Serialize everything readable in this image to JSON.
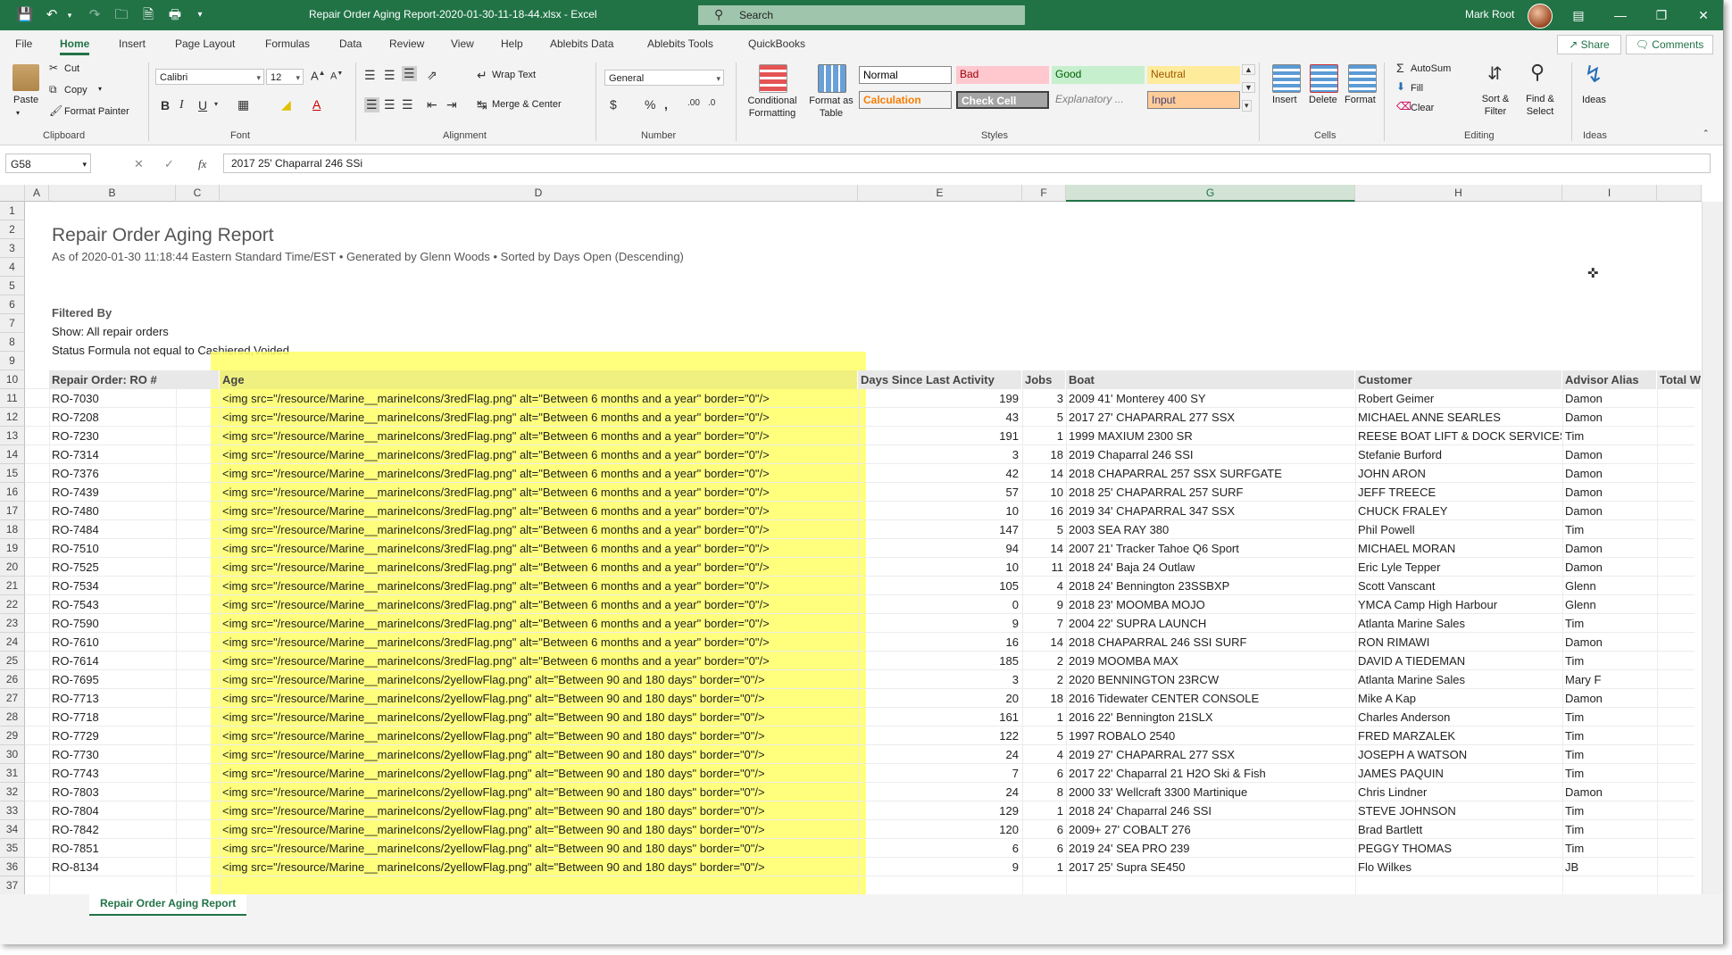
{
  "window": {
    "title": "Repair Order Aging Report-2020-01-30-11-18-44.xlsx  -  Excel",
    "search_placeholder": "Search",
    "user": "Mark Root"
  },
  "menu": {
    "tabs": [
      "File",
      "Home",
      "Insert",
      "Page Layout",
      "Formulas",
      "Data",
      "Review",
      "View",
      "Help",
      "Ablebits Data",
      "Ablebits Tools",
      "QuickBooks"
    ],
    "share": "Share",
    "comments": "Comments"
  },
  "ribbon": {
    "clipboard": {
      "paste": "Paste",
      "cut": "Cut",
      "copy": "Copy",
      "format_painter": "Format Painter",
      "label": "Clipboard"
    },
    "font": {
      "name": "Calibri",
      "size": "12",
      "label": "Font"
    },
    "alignment": {
      "wrap": "Wrap Text",
      "merge": "Merge & Center",
      "label": "Alignment"
    },
    "number": {
      "format": "General",
      "label": "Number"
    },
    "styles": {
      "conditional": "Conditional Formatting",
      "format_table": "Format as Table",
      "normal": "Normal",
      "bad": "Bad",
      "good": "Good",
      "neutral": "Neutral",
      "calculation": "Calculation",
      "check_cell": "Check Cell",
      "explanatory": "Explanatory ...",
      "input": "Input",
      "label": "Styles"
    },
    "cells": {
      "insert": "Insert",
      "delete": "Delete",
      "format": "Format",
      "label": "Cells"
    },
    "editing": {
      "autosum": "AutoSum",
      "fill": "Fill",
      "clear": "Clear",
      "sort": "Sort & Filter",
      "find": "Find & Select",
      "label": "Editing"
    },
    "ideas": {
      "ideas": "Ideas",
      "label": "Ideas"
    }
  },
  "formula_bar": {
    "name_box": "G58",
    "formula": "2017 25' Chaparral 246 SSi"
  },
  "columns": [
    "A",
    "B",
    "C",
    "D",
    "E",
    "F",
    "G",
    "H",
    "I"
  ],
  "sheet": {
    "title": "Repair Order Aging Report",
    "subtitle": "As of 2020-01-30 11:18:44 Eastern Standard Time/EST • Generated by Glenn Woods • Sorted by Days Open (Descending)",
    "filtered_by": "Filtered By",
    "filter1": "Show: All repair orders",
    "filter2": "Status Formula not equal to Cashiered,Voided",
    "headers": [
      "Repair Order: RO #",
      "Age",
      "Days Since Last Activity",
      "Jobs",
      "Boat",
      "Customer",
      "Advisor Alias",
      "Total W"
    ],
    "rows": [
      [
        "RO-7030",
        "<img src=\"/resource/Marine__marineIcons/3redFlag.png\" alt=\"Between 6 months and a year\" border=\"0\"/>",
        "199",
        "3",
        "2009 41' Monterey 400 SY",
        "Robert Geimer",
        "Damon"
      ],
      [
        "RO-7208",
        "<img src=\"/resource/Marine__marineIcons/3redFlag.png\" alt=\"Between 6 months and a year\" border=\"0\"/>",
        "43",
        "5",
        "2017 27' CHAPARRAL 277 SSX",
        "MICHAEL ANNE SEARLES",
        "Damon"
      ],
      [
        "RO-7230",
        "<img src=\"/resource/Marine__marineIcons/3redFlag.png\" alt=\"Between 6 months and a year\" border=\"0\"/>",
        "191",
        "1",
        "1999 MAXIUM 2300 SR",
        "REESE BOAT LIFT & DOCK SERVICES",
        "Tim"
      ],
      [
        "RO-7314",
        "<img src=\"/resource/Marine__marineIcons/3redFlag.png\" alt=\"Between 6 months and a year\" border=\"0\"/>",
        "3",
        "18",
        "2019 Chaparral 246 SSI",
        "Stefanie Burford",
        "Damon"
      ],
      [
        "RO-7376",
        "<img src=\"/resource/Marine__marineIcons/3redFlag.png\" alt=\"Between 6 months and a year\" border=\"0\"/>",
        "42",
        "14",
        "2018 CHAPARRAL 257 SSX SURFGATE",
        "JOHN ARON",
        "Damon"
      ],
      [
        "RO-7439",
        "<img src=\"/resource/Marine__marineIcons/3redFlag.png\" alt=\"Between 6 months and a year\" border=\"0\"/>",
        "57",
        "10",
        "2018 25' CHAPARRAL 257 SURF",
        "JEFF TREECE",
        "Damon"
      ],
      [
        "RO-7480",
        "<img src=\"/resource/Marine__marineIcons/3redFlag.png\" alt=\"Between 6 months and a year\" border=\"0\"/>",
        "10",
        "16",
        "2019 34' CHAPARRAL 347 SSX",
        "CHUCK FRALEY",
        "Damon"
      ],
      [
        "RO-7484",
        "<img src=\"/resource/Marine__marineIcons/3redFlag.png\" alt=\"Between 6 months and a year\" border=\"0\"/>",
        "147",
        "5",
        "2003 SEA RAY 380",
        "Phil Powell",
        "Tim"
      ],
      [
        "RO-7510",
        "<img src=\"/resource/Marine__marineIcons/3redFlag.png\" alt=\"Between 6 months and a year\" border=\"0\"/>",
        "94",
        "14",
        "2007 21' Tracker Tahoe Q6 Sport",
        "MICHAEL MORAN",
        "Damon"
      ],
      [
        "RO-7525",
        "<img src=\"/resource/Marine__marineIcons/3redFlag.png\" alt=\"Between 6 months and a year\" border=\"0\"/>",
        "10",
        "11",
        "2018 24' Baja 24 Outlaw",
        "Eric Lyle Tepper",
        "Damon"
      ],
      [
        "RO-7534",
        "<img src=\"/resource/Marine__marineIcons/3redFlag.png\" alt=\"Between 6 months and a year\" border=\"0\"/>",
        "105",
        "4",
        "2018 24' Bennington 23SSBXP",
        "Scott Vanscant",
        "Glenn"
      ],
      [
        "RO-7543",
        "<img src=\"/resource/Marine__marineIcons/3redFlag.png\" alt=\"Between 6 months and a year\" border=\"0\"/>",
        "0",
        "9",
        "2018 23' MOOMBA MOJO",
        "YMCA Camp High Harbour",
        "Glenn"
      ],
      [
        "RO-7590",
        "<img src=\"/resource/Marine__marineIcons/3redFlag.png\" alt=\"Between 6 months and a year\" border=\"0\"/>",
        "9",
        "7",
        "2004 22' SUPRA LAUNCH",
        "Atlanta Marine Sales",
        "Tim"
      ],
      [
        "RO-7610",
        "<img src=\"/resource/Marine__marineIcons/3redFlag.png\" alt=\"Between 6 months and a year\" border=\"0\"/>",
        "16",
        "14",
        "2018 CHAPARRAL 246 SSI SURF",
        "RON RIMAWI",
        "Damon"
      ],
      [
        "RO-7614",
        "<img src=\"/resource/Marine__marineIcons/3redFlag.png\" alt=\"Between 6 months and a year\" border=\"0\"/>",
        "185",
        "2",
        "2019 MOOMBA MAX",
        "DAVID A TIEDEMAN",
        "Tim"
      ],
      [
        "RO-7695",
        "<img src=\"/resource/Marine__marineIcons/2yellowFlag.png\" alt=\"Between 90 and 180 days\" border=\"0\"/>",
        "3",
        "2",
        "2020 BENNINGTON 23RCW",
        "Atlanta Marine Sales",
        "Mary F"
      ],
      [
        "RO-7713",
        "<img src=\"/resource/Marine__marineIcons/2yellowFlag.png\" alt=\"Between 90 and 180 days\" border=\"0\"/>",
        "20",
        "18",
        "2016 Tidewater CENTER CONSOLE",
        "Mike A Kap",
        "Damon"
      ],
      [
        "RO-7718",
        "<img src=\"/resource/Marine__marineIcons/2yellowFlag.png\" alt=\"Between 90 and 180 days\" border=\"0\"/>",
        "161",
        "1",
        "2016 22' Bennington 21SLX",
        "Charles Anderson",
        "Tim"
      ],
      [
        "RO-7729",
        "<img src=\"/resource/Marine__marineIcons/2yellowFlag.png\" alt=\"Between 90 and 180 days\" border=\"0\"/>",
        "122",
        "5",
        "1997 ROBALO 2540",
        "FRED MARZALEK",
        "Tim"
      ],
      [
        "RO-7730",
        "<img src=\"/resource/Marine__marineIcons/2yellowFlag.png\" alt=\"Between 90 and 180 days\" border=\"0\"/>",
        "24",
        "4",
        "2019 27' CHAPARRAL 277 SSX",
        "JOSEPH A WATSON",
        "Tim"
      ],
      [
        "RO-7743",
        "<img src=\"/resource/Marine__marineIcons/2yellowFlag.png\" alt=\"Between 90 and 180 days\" border=\"0\"/>",
        "7",
        "6",
        "2017 22' Chaparral 21 H2O Ski & Fish",
        "JAMES PAQUIN",
        "Tim"
      ],
      [
        "RO-7803",
        "<img src=\"/resource/Marine__marineIcons/2yellowFlag.png\" alt=\"Between 90 and 180 days\" border=\"0\"/>",
        "24",
        "8",
        "2000 33' Wellcraft 3300 Martinique",
        "Chris Lindner",
        "Damon"
      ],
      [
        "RO-7804",
        "<img src=\"/resource/Marine__marineIcons/2yellowFlag.png\" alt=\"Between 90 and 180 days\" border=\"0\"/>",
        "129",
        "1",
        "2018 24' Chaparral 246 SSI",
        "STEVE JOHNSON",
        "Tim"
      ],
      [
        "RO-7842",
        "<img src=\"/resource/Marine__marineIcons/2yellowFlag.png\" alt=\"Between 90 and 180 days\" border=\"0\"/>",
        "120",
        "6",
        "2009+ 27' COBALT 276",
        "Brad Bartlett",
        "Tim"
      ],
      [
        "RO-7851",
        "<img src=\"/resource/Marine__marineIcons/2yellowFlag.png\" alt=\"Between 90 and 180 days\" border=\"0\"/>",
        "6",
        "6",
        "2019 24' SEA PRO 239",
        "PEGGY THOMAS",
        "Tim"
      ],
      [
        "RO-8134",
        "<img src=\"/resource/Marine__marineIcons/2yellowFlag.png\" alt=\"Between 90 and 180 days\" border=\"0\"/>",
        "9",
        "1",
        "2017 25' Supra SE450",
        "Flo Wilkes",
        "JB"
      ]
    ]
  },
  "sheet_tab": "Repair Order Aging Report",
  "colors": {
    "excel_green": "#217346",
    "highlight": "#ffff66"
  }
}
